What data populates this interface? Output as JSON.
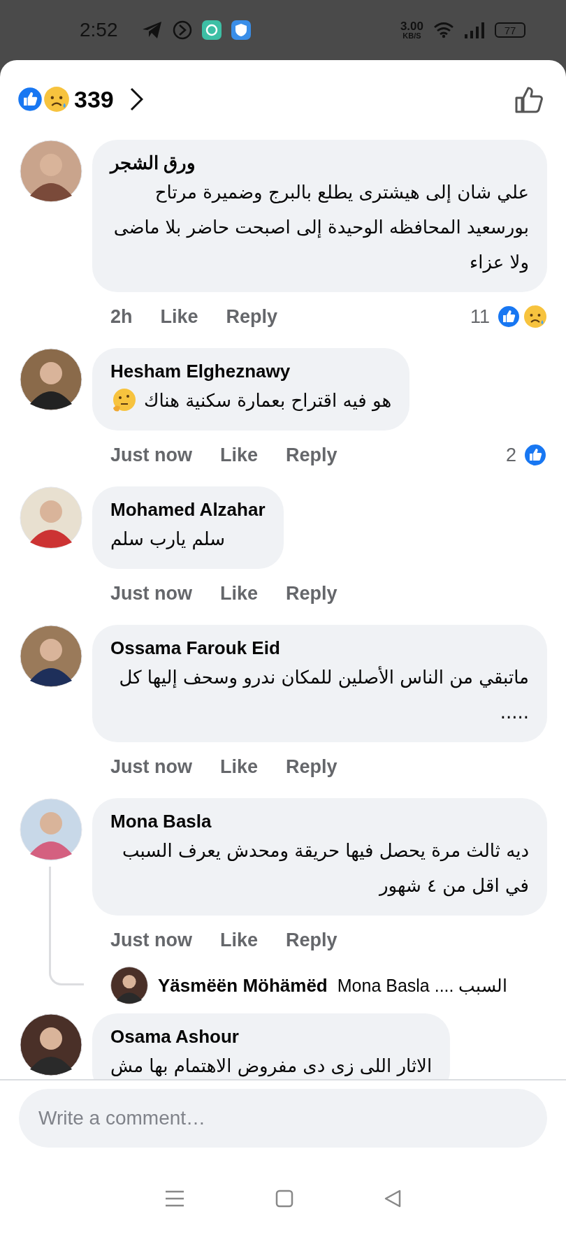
{
  "status_bar": {
    "time": "2:52",
    "speed": "3.00",
    "speed_unit": "KB/S",
    "battery": "77"
  },
  "header": {
    "reactions": [
      {
        "kind": "like"
      },
      {
        "kind": "sad"
      }
    ],
    "count": "339"
  },
  "comments": [
    {
      "author": "ورق الشجر",
      "text": "علي  شان إلى هيشترى يطلع بالبرج  وضميرة مرتاح بورسعيد المحافظه الوحيدة إلى  اصبحت حاضر بلا ماضى ولا عزاء",
      "has_emoji": false,
      "time": "2h",
      "like": "Like",
      "reply": "Reply",
      "reaction_count": "11",
      "reactions": [
        {
          "kind": "like"
        },
        {
          "kind": "sad"
        }
      ]
    },
    {
      "author": "Hesham Elgheznawy",
      "text": "هو فيه اقتراح بعمارة سكنية هناك",
      "has_emoji": true,
      "time": "Just now",
      "like": "Like",
      "reply": "Reply",
      "reaction_count": "2",
      "reactions": [
        {
          "kind": "like"
        }
      ]
    },
    {
      "author": "Mohamed Alzahar",
      "text": "سلم يارب سلم",
      "has_emoji": false,
      "time": "Just now",
      "like": "Like",
      "reply": "Reply"
    },
    {
      "author": "Ossama Farouk Eid",
      "text": "ماتبقي من الناس الأصلين للمكان ندرو وسحف إليها كل .....",
      "has_emoji": false,
      "time": "Just now",
      "like": "Like",
      "reply": "Reply"
    },
    {
      "author": "Mona Basla",
      "text": "ديه ثالث مرة يحصل فيها حريقة ومحدش يعرف السبب في اقل من ٤ شهور",
      "has_emoji": false,
      "time": "Just now",
      "like": "Like",
      "reply": "Reply",
      "replies": [
        {
          "author": "Yäsmëën Möhämëd",
          "text": "Mona Basla .... السبب"
        }
      ]
    },
    {
      "author": "Osama Ashour",
      "text": "الاثار اللى زى دى مفروض الاهتمام بها مش",
      "has_emoji": false
    }
  ],
  "composer": {
    "placeholder": "Write a comment…"
  }
}
